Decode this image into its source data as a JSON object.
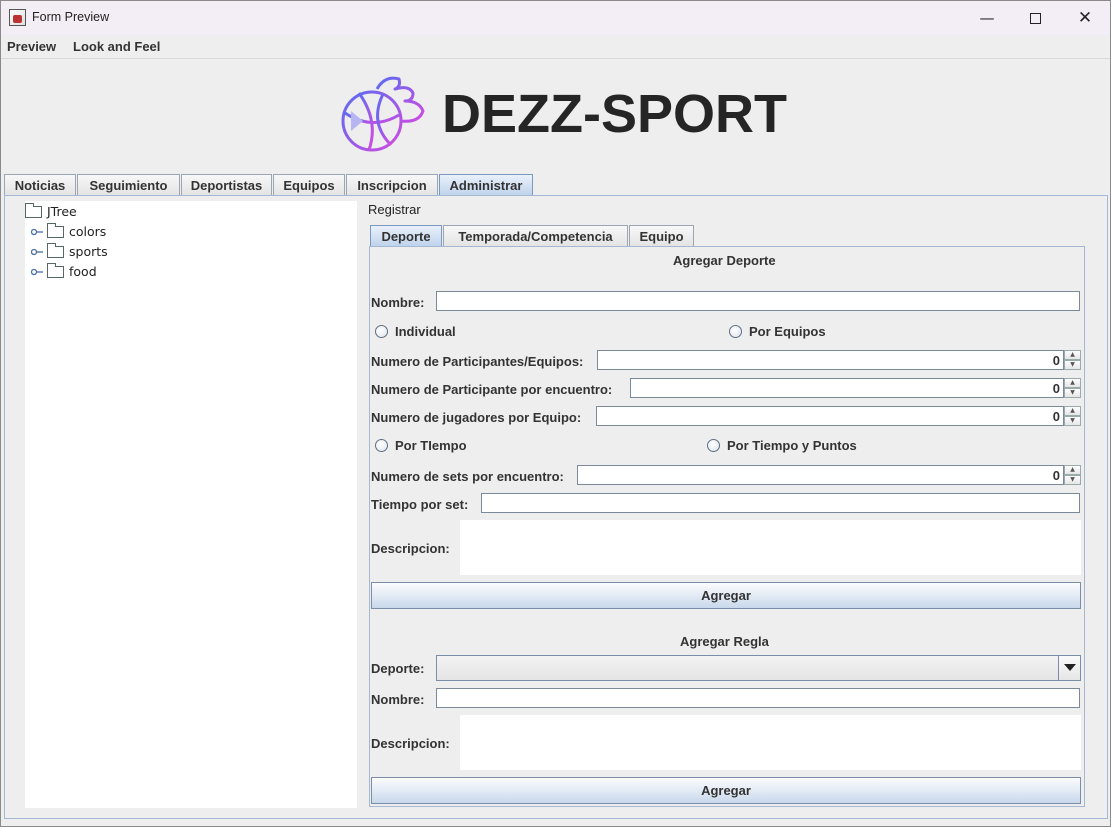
{
  "window": {
    "title": "Form Preview",
    "minimize_icon": "minimize-icon",
    "maximize_icon": "maximize-icon",
    "close_icon": "close-icon"
  },
  "menubar": {
    "items": [
      {
        "label": "Preview",
        "mnemonic": "P"
      },
      {
        "label": "Look and Feel",
        "mnemonic": "L"
      }
    ]
  },
  "header": {
    "brand": "DEZZ-SPORT",
    "logo_icon": "basketball-logo-icon",
    "logo_colors": [
      "#6a5cf0",
      "#c04be0"
    ]
  },
  "main_tabs": [
    {
      "label": "Noticias",
      "selected": false
    },
    {
      "label": "Seguimiento",
      "selected": false
    },
    {
      "label": "Deportistas",
      "selected": false
    },
    {
      "label": "Equipos",
      "selected": false
    },
    {
      "label": "Inscripcion",
      "selected": false
    },
    {
      "label": "Administrar",
      "selected": true
    }
  ],
  "tree": {
    "root": "JTree",
    "children": [
      "colors",
      "sports",
      "food"
    ]
  },
  "registrar": {
    "label": "Registrar",
    "tabs": [
      {
        "label": "Deporte",
        "selected": true
      },
      {
        "label": "Temporada/Competencia",
        "selected": false
      },
      {
        "label": "Equipo",
        "selected": false
      }
    ]
  },
  "agregar_deporte": {
    "title": "Agregar Deporte",
    "nombre_label": "Nombre:",
    "nombre_value": "",
    "radio_individual": "Individual",
    "radio_por_equipos": "Por Equipos",
    "num_participantes_label": "Numero de Participantes/Equipos:",
    "num_participantes_value": "0",
    "num_por_encuentro_label": "Numero de Participante por encuentro:",
    "num_por_encuentro_value": "0",
    "num_jugadores_label": "Numero de jugadores por Equipo:",
    "num_jugadores_value": "0",
    "radio_por_tiempo": "Por TIempo",
    "radio_tiempo_puntos": "Por Tiempo y Puntos",
    "num_sets_label": "Numero de sets por encuentro:",
    "num_sets_value": "0",
    "tiempo_set_label": "Tiempo por set:",
    "tiempo_set_value": "",
    "descripcion_label": "Descripcion:",
    "descripcion_value": "",
    "agregar_button": "Agregar"
  },
  "agregar_regla": {
    "title": "Agregar Regla",
    "deporte_label": "Deporte:",
    "deporte_selected": "",
    "nombre_label": "Nombre:",
    "nombre_value": "",
    "descripcion_label": "Descripcion:",
    "descripcion_value": "",
    "agregar_button": "Agregar"
  },
  "colors": {
    "selected_tab": "#bfd3ec",
    "panel_border": "#a5b8d3",
    "background": "#eeeeee"
  }
}
